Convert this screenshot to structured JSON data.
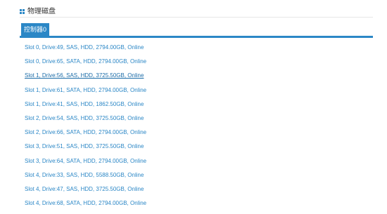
{
  "panel": {
    "title": "物理磁盘",
    "icon": "grid-icon",
    "accent_color": "#2b87c6"
  },
  "tabs": [
    {
      "label": "控制器0",
      "active": true
    }
  ],
  "drives": [
    {
      "label": "Slot 0, Drive:49, SAS, HDD, 2794.00GB, Online",
      "highlighted": false
    },
    {
      "label": "Slot 0, Drive:65, SATA, HDD, 2794.00GB, Online",
      "highlighted": false
    },
    {
      "label": "Slot 1, Drive:56, SAS, HDD, 3725.50GB, Online",
      "highlighted": true
    },
    {
      "label": "Slot 1, Drive:61, SATA, HDD, 2794.00GB, Online",
      "highlighted": false
    },
    {
      "label": "Slot 1, Drive:41, SAS, HDD, 1862.50GB, Online",
      "highlighted": false
    },
    {
      "label": "Slot 2, Drive:54, SAS, HDD, 3725.50GB, Online",
      "highlighted": false
    },
    {
      "label": "Slot 2, Drive:66, SATA, HDD, 2794.00GB, Online",
      "highlighted": false
    },
    {
      "label": "Slot 3, Drive:51, SAS, HDD, 3725.50GB, Online",
      "highlighted": false
    },
    {
      "label": "Slot 3, Drive:64, SATA, HDD, 2794.00GB, Online",
      "highlighted": false
    },
    {
      "label": "Slot 4, Drive:33, SAS, HDD, 5588.50GB, Online",
      "highlighted": false
    },
    {
      "label": "Slot 4, Drive:47, SAS, HDD, 3725.50GB, Online",
      "highlighted": false
    },
    {
      "label": "Slot 4, Drive:68, SATA, HDD, 2794.00GB, Online",
      "highlighted": false
    }
  ]
}
